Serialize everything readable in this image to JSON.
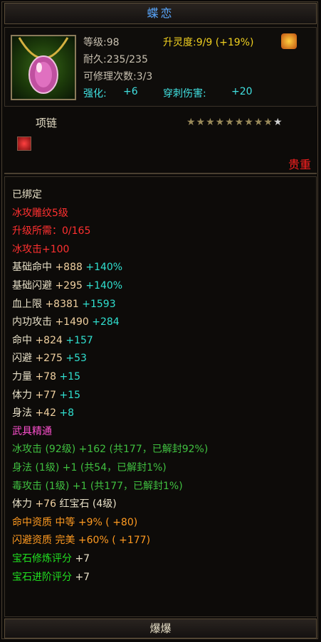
{
  "item": {
    "name": "蝶恋",
    "type": "项链",
    "rarity": "贵重",
    "bottom": "爆爆"
  },
  "stats": {
    "level": "等级:98",
    "spirit": "升灵度:9/9 (+19%)",
    "durability": "耐久:235/235",
    "repair": "可修理次数:3/3",
    "enhance_label": "强化:",
    "enhance_value": "+6",
    "pierce_label": "穿刺伤害:",
    "pierce_value": "+20"
  },
  "stars": {
    "filled": 9,
    "total": 10,
    "on": "★★★★★★★★★",
    "off": "★"
  },
  "attributes": [
    {
      "text": "已绑定",
      "color": "w"
    },
    {
      "text": "冰攻雕纹5级",
      "color": "r"
    },
    {
      "text": "升级所需：0/165",
      "color": "r"
    },
    {
      "text": "冰攻击+100",
      "color": "r"
    },
    {
      "parts": [
        {
          "t": "基础命中",
          "c": "w"
        },
        {
          "t": " +888",
          "c": "y"
        },
        {
          "t": " +140%",
          "c": "c"
        }
      ]
    },
    {
      "parts": [
        {
          "t": "基础闪避",
          "c": "w"
        },
        {
          "t": " +295",
          "c": "y"
        },
        {
          "t": " +140%",
          "c": "c"
        }
      ]
    },
    {
      "parts": [
        {
          "t": "血上限",
          "c": "w"
        },
        {
          "t": " +8381",
          "c": "y"
        },
        {
          "t": " +1593",
          "c": "c"
        }
      ]
    },
    {
      "parts": [
        {
          "t": "内功攻击",
          "c": "w"
        },
        {
          "t": " +1490",
          "c": "y"
        },
        {
          "t": " +284",
          "c": "c"
        }
      ]
    },
    {
      "parts": [
        {
          "t": "命中",
          "c": "w"
        },
        {
          "t": " +824",
          "c": "y"
        },
        {
          "t": " +157",
          "c": "c"
        }
      ]
    },
    {
      "parts": [
        {
          "t": "闪避",
          "c": "w"
        },
        {
          "t": " +275",
          "c": "y"
        },
        {
          "t": " +53",
          "c": "c"
        }
      ]
    },
    {
      "parts": [
        {
          "t": "力量",
          "c": "w"
        },
        {
          "t": " +78",
          "c": "y"
        },
        {
          "t": " +15",
          "c": "c"
        }
      ]
    },
    {
      "parts": [
        {
          "t": "体力",
          "c": "w"
        },
        {
          "t": " +77",
          "c": "y"
        },
        {
          "t": " +15",
          "c": "c"
        }
      ]
    },
    {
      "parts": [
        {
          "t": "身法",
          "c": "w"
        },
        {
          "t": " +42",
          "c": "y"
        },
        {
          "t": " +8",
          "c": "c"
        }
      ]
    },
    {
      "text": "武具精通",
      "color": "p"
    },
    {
      "text": "冰攻击 (92级) +162 (共177，已解封92%)",
      "color": "g"
    },
    {
      "text": "身法 (1级) +1 (共54，已解封1%)",
      "color": "g"
    },
    {
      "text": "毒攻击 (1级) +1 (共177，已解封1%)",
      "color": "g"
    },
    {
      "parts": [
        {
          "t": "体力",
          "c": "w"
        },
        {
          "t": " +76 ",
          "c": "y"
        },
        {
          "t": "红宝石 (4级)",
          "c": "w"
        }
      ]
    },
    {
      "parts": [
        {
          "t": "命中资质",
          "c": "o"
        },
        {
          "t": "  中等",
          "c": "o"
        },
        {
          "t": " +9% ( +80)",
          "c": "o"
        }
      ]
    },
    {
      "parts": [
        {
          "t": "闪避资质",
          "c": "o"
        },
        {
          "t": "  完美",
          "c": "o"
        },
        {
          "t": " +60% ( +177)",
          "c": "o"
        }
      ]
    },
    {
      "parts": [
        {
          "t": "宝石修炼评分",
          "c": "gr"
        },
        {
          "t": " +7",
          "c": "w"
        }
      ]
    },
    {
      "parts": [
        {
          "t": "宝石进阶评分",
          "c": "gr"
        },
        {
          "t": " +7",
          "c": "w"
        }
      ]
    }
  ]
}
